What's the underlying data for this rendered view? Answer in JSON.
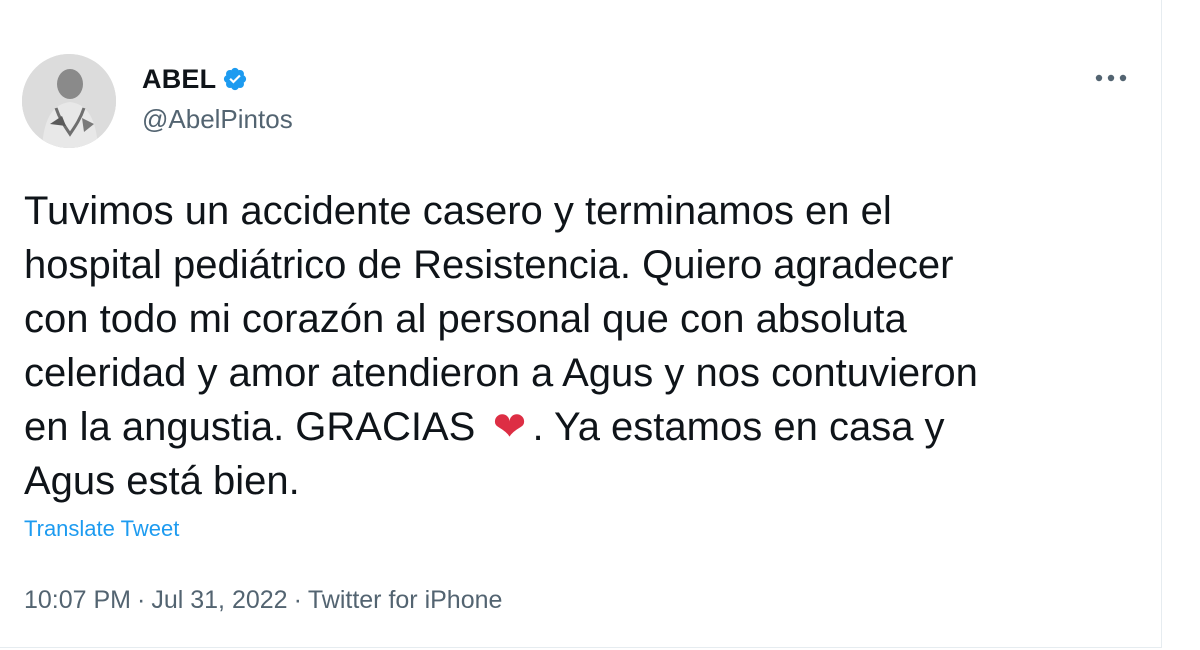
{
  "tweet": {
    "author": {
      "display_name": "ABEL",
      "handle": "@AbelPintos",
      "verified": true,
      "verified_icon": "verified-badge-icon",
      "avatar_icon": "profile-photo"
    },
    "more_icon": "more-options-icon",
    "text_lines": [
      "Tuvimos un accidente casero y terminamos en el",
      "hospital pediátrico de Resistencia. Quiero agradecer",
      "con todo mi corazón al personal que con absoluta",
      "celeridad y amor atendieron a Agus y nos contuvieron",
      "en la angustia. GRACIAS",
      ". Ya estamos en casa y",
      "Agus está bien."
    ],
    "emoji": "❤",
    "translate_label": "Translate Tweet",
    "meta": {
      "time": "10:07 PM",
      "separator": "·",
      "date": "Jul 31, 2022",
      "source": "Twitter for iPhone"
    },
    "colors": {
      "accent": "#1d9bf0",
      "text": "#0f1419",
      "secondary": "#536471",
      "heart": "#dd2e44"
    }
  }
}
